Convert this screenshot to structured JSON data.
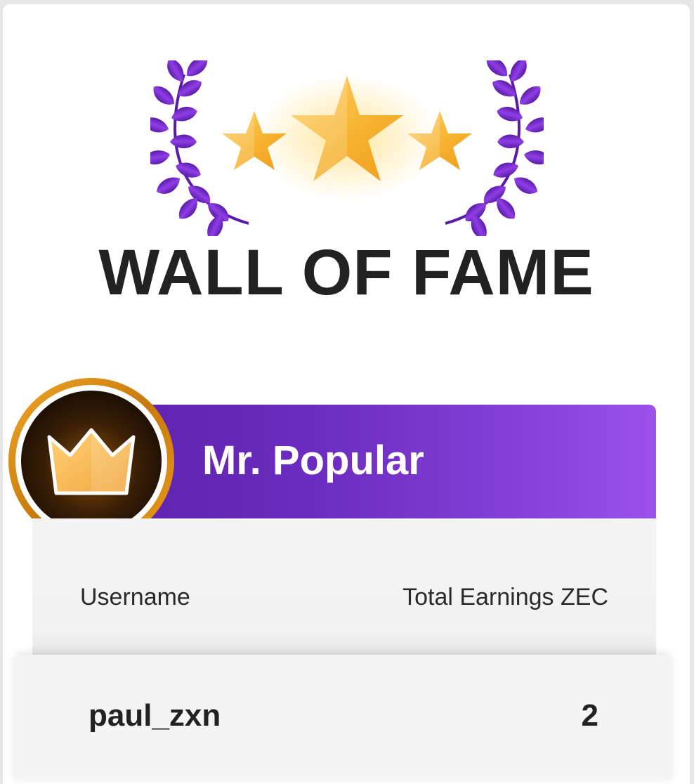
{
  "page": {
    "title": "WALL OF FAME"
  },
  "leaderboard": {
    "category_label": "Mr. Popular",
    "columns": {
      "username": "Username",
      "earnings": "Total Earnings ZEC"
    },
    "rows": [
      {
        "username": "paul_zxn",
        "value": "2"
      }
    ]
  },
  "icons": {
    "emblem": "laurel-stars-icon",
    "badge": "crown-icon"
  },
  "colors": {
    "banner_start": "#5a1ea6",
    "banner_end": "#9b52ec",
    "laurel": "#7b2fd6",
    "star": "#f7b631",
    "badge_ring": "#d28a12",
    "title_text": "#222222"
  }
}
